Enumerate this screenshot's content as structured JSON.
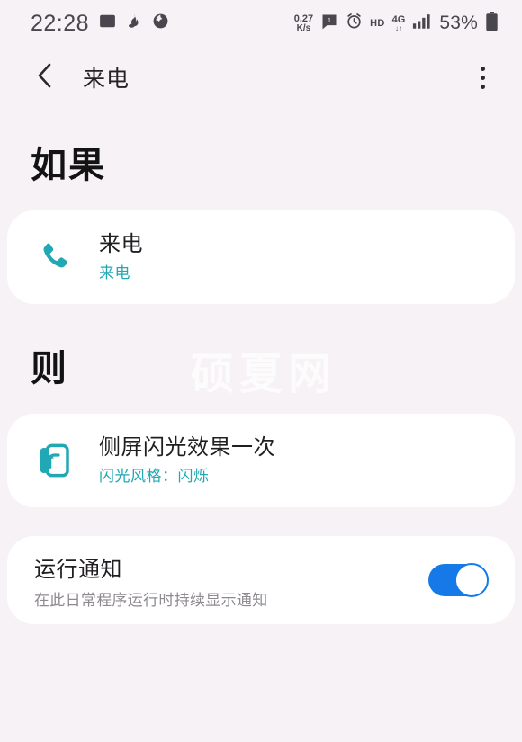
{
  "status_bar": {
    "clock": "22:28",
    "left_icons": [
      "image-icon",
      "app-icon-1",
      "app-icon-2"
    ],
    "net_speed_value": "0.27",
    "net_speed_unit": "K/s",
    "right_icons": [
      "message-icon",
      "alarm-icon"
    ],
    "hd_label": "HD",
    "network_type": "4G",
    "network_arrows": "↓↑",
    "signal_icon": "signal-bars-icon",
    "battery_percent": "53%",
    "battery_icon": "battery-icon"
  },
  "app_bar": {
    "back_icon": "back-chevron-icon",
    "title": "来电",
    "overflow_icon": "more-vertical-icon"
  },
  "sections": {
    "if_header": "如果",
    "then_header": "则"
  },
  "trigger_card": {
    "icon": "phone-icon",
    "icon_color": "#20a8b4",
    "title": "来电",
    "subtitle": "来电"
  },
  "action_card": {
    "icon": "edge-lighting-icon",
    "icon_color": "#20a8b4",
    "title": "侧屏闪光效果一次",
    "subtitle": "闪光风格：闪烁"
  },
  "notification_card": {
    "title": "运行通知",
    "subtitle": "在此日常程序运行时持续显示通知",
    "toggle_state": "on",
    "toggle_color": "#1579e8"
  },
  "watermark": {
    "text": "硕夏网"
  },
  "colors": {
    "background": "#f7f2f5",
    "card": "#ffffff",
    "accent_teal": "#20a8b4",
    "accent_blue": "#1579e8",
    "text_primary": "#201e21",
    "text_secondary": "#8e8a90"
  }
}
